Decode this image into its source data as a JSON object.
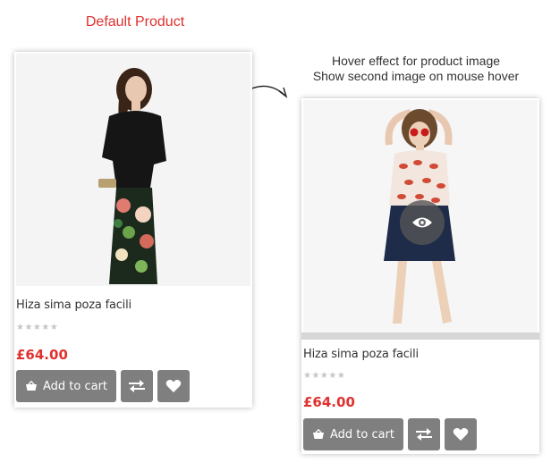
{
  "captions": {
    "default": "Default Product",
    "hover_line1": "Hover effect for product image",
    "hover_line2": "Show second image on mouse hover"
  },
  "products": [
    {
      "title": "Hiza sima poza facili",
      "rating": 0,
      "stars": "★★★★★",
      "price": "£64.00",
      "add_to_cart": "Add to cart",
      "compare_icon": "compare-arrows-icon",
      "wishlist_icon": "heart-icon"
    },
    {
      "title": "Hiza sima poza facili",
      "rating": 0,
      "stars": "★★★★★",
      "price": "£64.00",
      "add_to_cart": "Add to cart",
      "compare_icon": "compare-arrows-icon",
      "wishlist_icon": "heart-icon",
      "quick_view_icon": "eye-icon"
    }
  ],
  "colors": {
    "accent_red": "#e0312f",
    "button_gray": "#7f7f7f",
    "star_gray": "#c6c6c6"
  }
}
